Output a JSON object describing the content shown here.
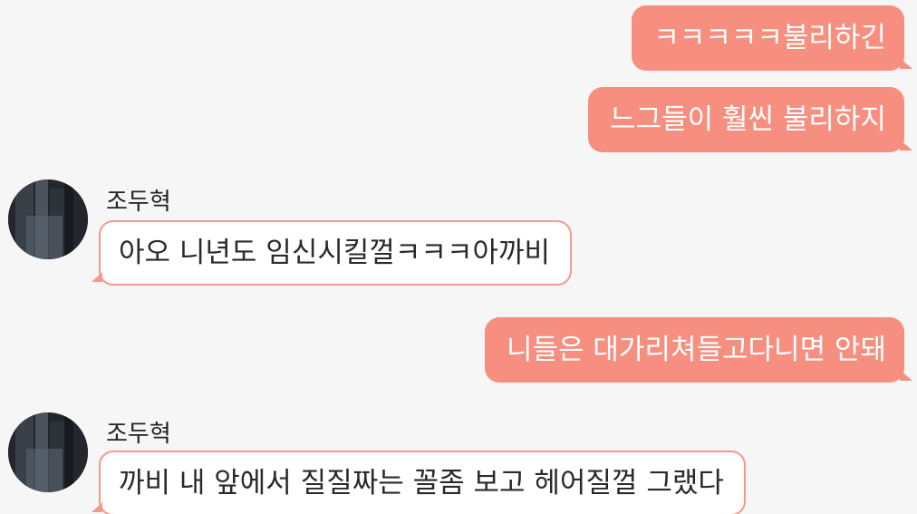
{
  "colors": {
    "outgoing_bubble": "#f68f7f",
    "incoming_border": "#f29a8c",
    "background": "#f6f6f6"
  },
  "messages": [
    {
      "id": "m1",
      "direction": "out",
      "text": "ㅋㅋㅋㅋㅋ불리하긴"
    },
    {
      "id": "m2",
      "direction": "out",
      "text": "느그들이 훨씬 불리하지"
    },
    {
      "id": "m3",
      "direction": "in",
      "sender": "조두혁",
      "text": "아오 니년도 임신시킬껄ㅋㅋㅋ아까비"
    },
    {
      "id": "m4",
      "direction": "out",
      "text": "니들은 대가리쳐들고다니면 안돼"
    },
    {
      "id": "m5",
      "direction": "in",
      "sender": "조두혁",
      "text": "까비 내 앞에서 질질짜는 꼴좀 보고 헤어질껄 그랬다"
    }
  ]
}
